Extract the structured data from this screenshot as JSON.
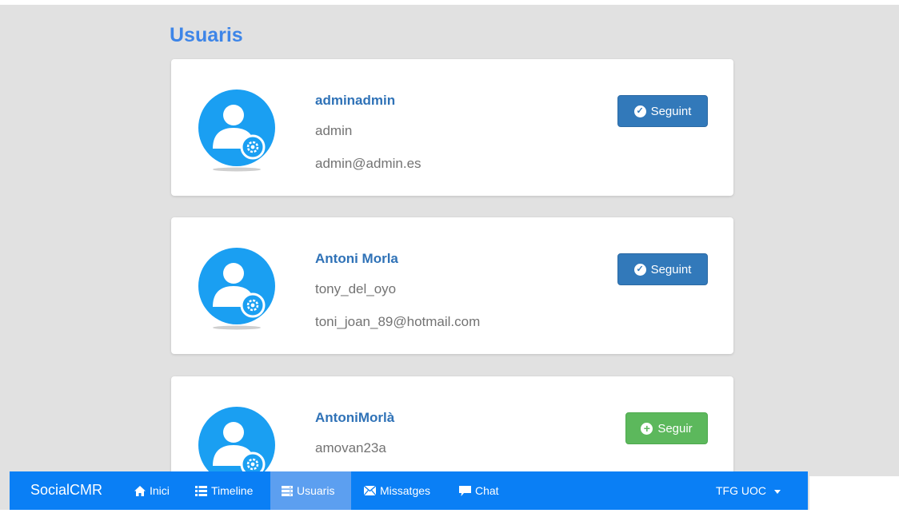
{
  "page": {
    "title": "Usuaris"
  },
  "users": [
    {
      "name": "adminadmin",
      "username": "admin",
      "email": "admin@admin.es",
      "button_label": "Seguint",
      "button_state": "following"
    },
    {
      "name": "Antoni Morla",
      "username": "tony_del_oyo",
      "email": "toni_joan_89@hotmail.com",
      "button_label": "Seguint",
      "button_state": "following"
    },
    {
      "name": "AntoniMorlà",
      "username": "amovan23a",
      "email": "",
      "button_label": "Seguir",
      "button_state": "follow"
    }
  ],
  "navbar": {
    "brand": "SocialCMR",
    "items": [
      {
        "label": "Inici",
        "icon": "home-icon"
      },
      {
        "label": "Timeline",
        "icon": "list-icon"
      },
      {
        "label": "Usuaris",
        "icon": "server-icon",
        "active": true
      },
      {
        "label": "Missatges",
        "icon": "envelope-icon"
      },
      {
        "label": "Chat",
        "icon": "comment-icon"
      }
    ],
    "account": "TFG UOC"
  },
  "colors": {
    "navbar": "#0a7ff5",
    "navbar_active": "#5c9ff0",
    "title": "#3d85e8",
    "link": "#2f72b7",
    "button_following": "#3279ba",
    "button_follow": "#5cb85c",
    "avatar": "#1a9ff2",
    "background": "#e1e1e1"
  }
}
